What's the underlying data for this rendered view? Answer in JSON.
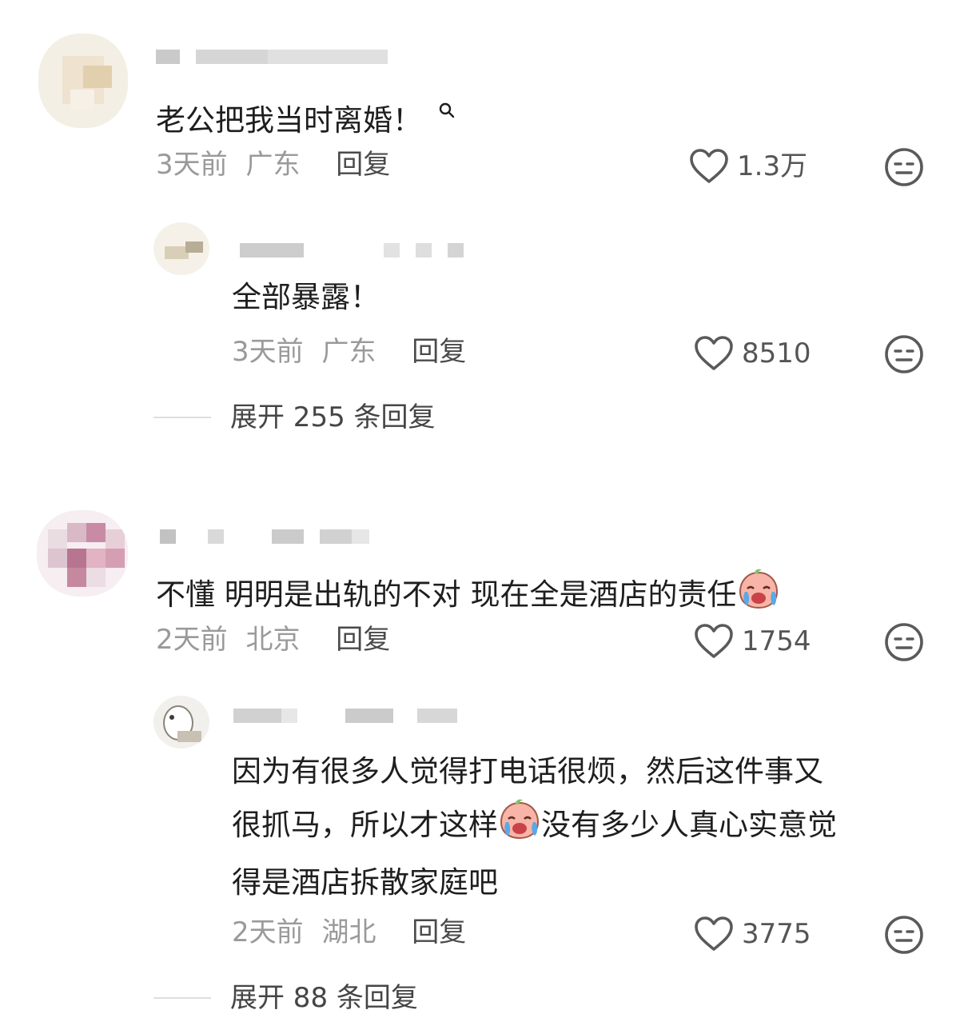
{
  "comments": [
    {
      "text": "老公把我当时离婚！",
      "time": "3天前",
      "location": "广东",
      "reply_label": "回复",
      "likes": "1.3万",
      "replies": [
        {
          "text": "全部暴露！",
          "time": "3天前",
          "location": "广东",
          "reply_label": "回复",
          "likes": "8510"
        }
      ],
      "expand_label": "展开 255 条回复"
    },
    {
      "text": "不懂 明明是出轨的不对 现在全是酒店的责任",
      "time": "2天前",
      "location": "北京",
      "reply_label": "回复",
      "likes": "1754",
      "replies": [
        {
          "text_line1": "因为有很多人觉得打电话很烦，然后这件事又",
          "text_line2a": "很抓马，所以才这样",
          "text_line2b": "没有多少人真心实意觉",
          "text_line3": "得是酒店拆散家庭吧",
          "time": "2天前",
          "location": "湖北",
          "reply_label": "回复",
          "likes": "3775"
        }
      ],
      "expand_label": "展开 88 条回复"
    }
  ],
  "icons": {
    "search_hint": "search-icon",
    "like": "heart-outline-icon",
    "dislike": "meh-face-icon",
    "crying": "crying-face-emoji"
  },
  "colors": {
    "text": "#1e1e1e",
    "meta": "#9a9a9a",
    "link": "#4a4a4a",
    "icon": "#5a5a5a"
  }
}
